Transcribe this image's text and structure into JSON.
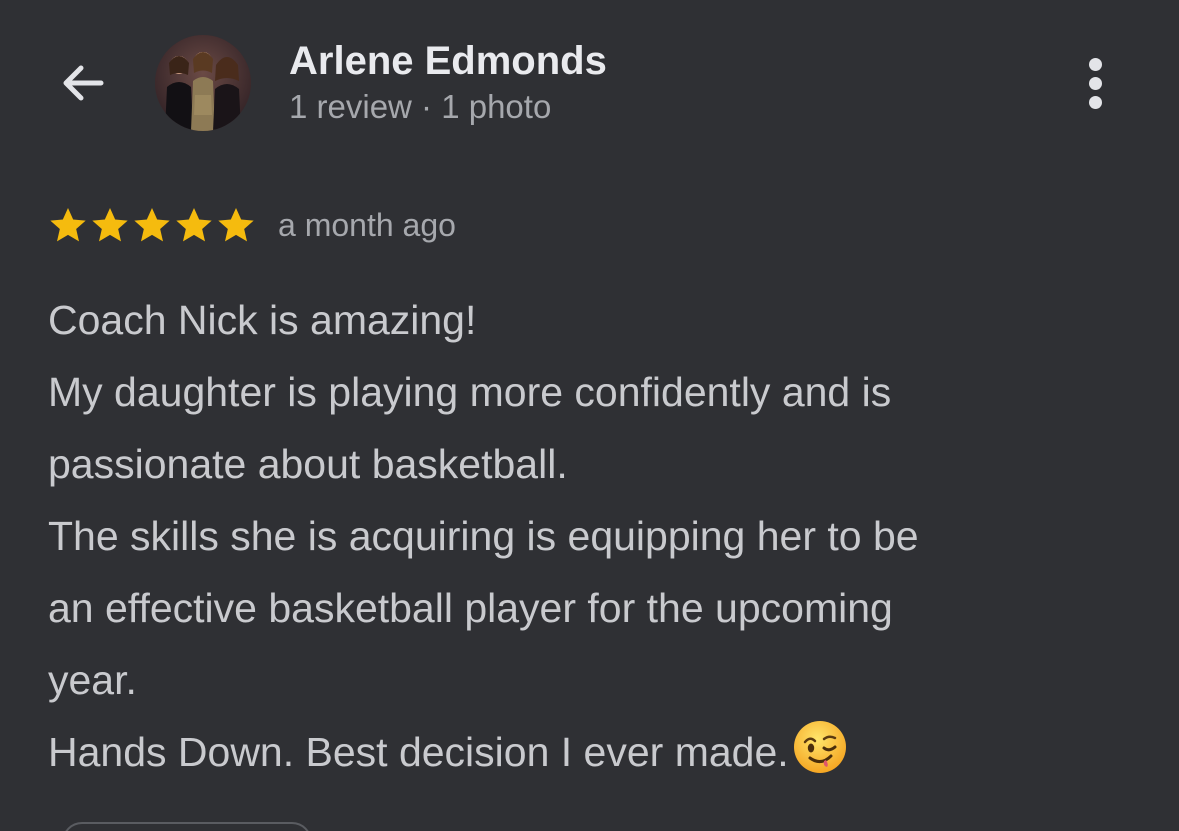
{
  "header": {
    "back_icon": "arrow-left-icon",
    "reviewer_name": "Arlene Edmonds",
    "reviewer_meta": "1 review · 1 photo",
    "more_icon": "more-vertical-icon"
  },
  "review": {
    "rating": 5,
    "max_rating": 5,
    "star_color": "#f5bb0e",
    "time": "a month ago",
    "lines": [
      "Coach Nick is amazing!",
      "My daughter is playing more confidently and is",
      "passionate about basketball.",
      "The skills she is acquiring is equipping her to be",
      "an effective basketball player for the upcoming",
      "year.",
      "Hands Down. Best decision I ever made."
    ],
    "emoji": "winking-face-emoji"
  },
  "colors": {
    "background": "#2f3034",
    "primary_text": "#e9eaee",
    "secondary_text": "#a6a8ad",
    "body_text": "#c9cace"
  }
}
